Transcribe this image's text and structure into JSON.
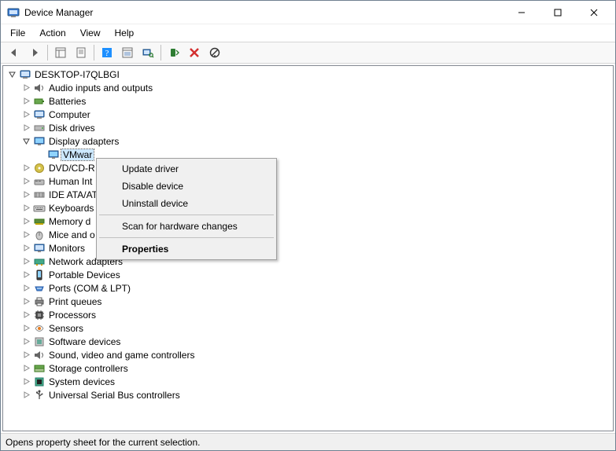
{
  "window": {
    "title": "Device Manager"
  },
  "menubar": {
    "file": "File",
    "action": "Action",
    "view": "View",
    "help": "Help"
  },
  "tree": {
    "root": "DESKTOP-I7QLBGI",
    "nodes": {
      "audio": "Audio inputs and outputs",
      "batteries": "Batteries",
      "computer": "Computer",
      "disk": "Disk drives",
      "display": "Display adapters",
      "display_child": "VMwar",
      "dvd": "DVD/CD-R",
      "hid": "Human Int",
      "ide": "IDE ATA/AT",
      "keyboards": "Keyboards",
      "memory": "Memory d",
      "mice": "Mice and o",
      "monitors": "Monitors",
      "network": "Network adapters",
      "portable": "Portable Devices",
      "ports": "Ports (COM & LPT)",
      "printq": "Print queues",
      "processors": "Processors",
      "sensors": "Sensors",
      "software": "Software devices",
      "sound": "Sound, video and game controllers",
      "storage": "Storage controllers",
      "system": "System devices",
      "usb": "Universal Serial Bus controllers"
    }
  },
  "context_menu": {
    "update": "Update driver",
    "disable": "Disable device",
    "uninstall": "Uninstall device",
    "scan": "Scan for hardware changes",
    "properties": "Properties"
  },
  "statusbar": {
    "text": "Opens property sheet for the current selection."
  }
}
